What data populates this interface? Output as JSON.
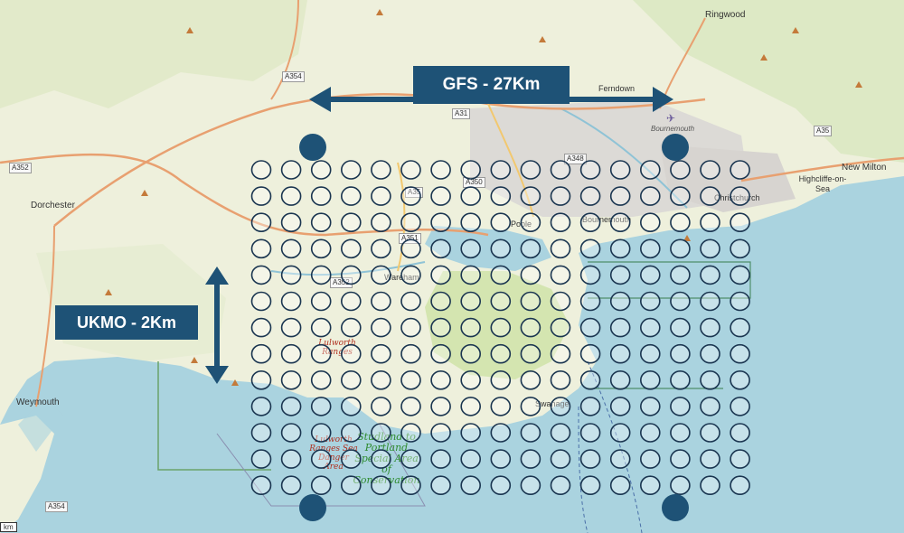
{
  "places": {
    "ringwood": "Ringwood",
    "ferndown": "Ferndown",
    "bournemouth_airport": "Bournemouth",
    "bournemouth": "Bournemouth",
    "christchurch": "Christchurch",
    "new_milton": "New Milton",
    "highcliffe": "Highcliffe-on-Sea",
    "dorchester": "Dorchester",
    "weymouth": "Weymouth",
    "wareham": "Wareham",
    "poole": "Poole",
    "swanage": "Swanage",
    "lulworth_ranges": "Lulworth Ranges",
    "lulworth_sea_danger": "Lulworth Ranges Sea Danger Area",
    "studland": "Studland to Portland Special Area of Conservation"
  },
  "roads": {
    "a354_north": "A354",
    "a352": "A352",
    "a31": "A31",
    "a350": "A350",
    "a348": "A348",
    "a35_east": "A35",
    "a35_mid": "A35",
    "a351": "A351",
    "a352_mid": "A352",
    "a354_south": "A354"
  },
  "scale_label": "km",
  "overlay": {
    "gfs_label": "GFS - 27Km",
    "ukmo_label": "UKMO - 2Km",
    "grid_rows": 13,
    "grid_cols": 17,
    "gfs_points": 4
  },
  "colors": {
    "sea": "#aad3df",
    "land": "#f2efe6",
    "banner": "#1e5276",
    "ring": "#1a3550",
    "grid_fill": "#ffffff"
  }
}
